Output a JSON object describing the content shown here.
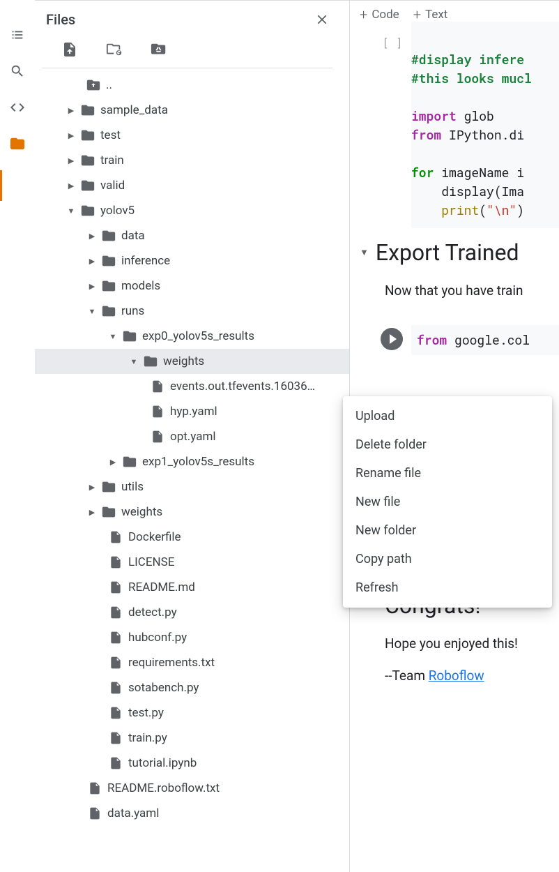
{
  "panel": {
    "title": "Files"
  },
  "toolbar": {
    "code_label": "Code",
    "text_label": "Text"
  },
  "tree": {
    "up": "..",
    "sample_data": "sample_data",
    "test": "test",
    "train": "train",
    "valid": "valid",
    "yolov5": "yolov5",
    "data": "data",
    "inference": "inference",
    "models": "models",
    "runs": "runs",
    "exp0": "exp0_yolov5s_results",
    "weights_sel": "weights",
    "events": "events.out.tfevents.16036…",
    "hyp": "hyp.yaml",
    "opt": "opt.yaml",
    "exp1": "exp1_yolov5s_results",
    "utils": "utils",
    "weights": "weights",
    "dockerfile": "Dockerfile",
    "license": "LICENSE",
    "readme_md": "README.md",
    "detect": "detect.py",
    "hubconf": "hubconf.py",
    "requirements": "requirements.txt",
    "sotabench": "sotabench.py",
    "testpy": "test.py",
    "trainpy": "train.py",
    "tutorial": "tutorial.ipynb",
    "readme_rf": "README.roboflow.txt",
    "datayaml": "data.yaml"
  },
  "code1": {
    "l1": "#display infere",
    "l2": "#this looks mucl",
    "l3": "import",
    "l3b": " glob",
    "l4a": "from",
    "l4b": " IPython.di",
    "l5a": "for",
    "l5b": " imageName i",
    "l6": "    display(Ima",
    "l7a": "    ",
    "l7p": "print",
    "l7b": "(",
    "l7s": "\"\\n\"",
    "l7c": ")"
  },
  "md": {
    "heading": "Export Trained",
    "para": "Now that you have train"
  },
  "code2": {
    "l1a": "from",
    "l1b": " google.col"
  },
  "md2": {
    "heading": "Congrats!",
    "p1": "Hope you enjoyed this!",
    "p2a": "--Team ",
    "p2b": "Roboflow"
  },
  "ctx": {
    "upload": "Upload",
    "delete": "Delete folder",
    "rename": "Rename file",
    "newfile": "New file",
    "newfolder": "New folder",
    "copypath": "Copy path",
    "refresh": "Refresh"
  }
}
